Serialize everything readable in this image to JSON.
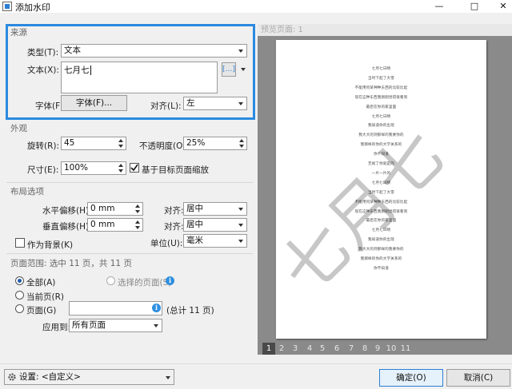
{
  "window": {
    "title": "添加水印",
    "minimize": "—",
    "maximize": "□",
    "close": "✕"
  },
  "source": {
    "header": "来源",
    "type_label": "类型(T):",
    "type_value": "文本",
    "text_label": "文本(X):",
    "text_value": "七月七",
    "insert_btn": "[…]",
    "font_label": "字体(F):",
    "font_btn": "字体(F)...",
    "align_label": "对齐(L):",
    "align_value": "左"
  },
  "appearance": {
    "header": "外观",
    "rotation_label": "旋转(R):",
    "rotation_value": "45",
    "opacity_label": "不透明度(O):",
    "opacity_value": "25%",
    "size_label": "尺寸(E):",
    "size_value": "100%",
    "scale_label": "基于目标页面缩放",
    "scale_checked": true
  },
  "layout": {
    "header": "布局选项",
    "h_offset_label": "水平偏移(H):",
    "h_offset_value": "0 mm",
    "h_align_label": "对齐:",
    "h_align_value": "居中",
    "v_offset_label": "垂直偏移(H):",
    "v_offset_value": "0 mm",
    "v_align_label": "对齐:",
    "v_align_value": "居中",
    "background_label": "作为背景(K)",
    "unit_label": "单位(U):",
    "unit_value": "毫米"
  },
  "page_range": {
    "header": "页面范围: 选中 11 页，共 11 页",
    "all_label": "全部(A)",
    "selected_label": "选择的页面(S)",
    "current_label": "当前页(R)",
    "pages_label": "页面(G)",
    "pages_value": "",
    "total_label": "(总计 11 页)",
    "apply_label": "应用到:",
    "apply_value": "所有页面"
  },
  "preview": {
    "header": "预览页面: 1",
    "watermark": "七月七",
    "doc_lines": [
      "七月七日晴",
      "当时下起了大雪",
      "不能用何某种种东西的比较比起",
      "现在这种东西我刚刚觉得很看到",
      "最后在你的家里面",
      "七月七日晴",
      "我知道你的出现",
      "我大大的到那样的我要你的",
      "我那样的你的大学关系的",
      "你不知道",
      "无视了你就是的",
      "一片一片的",
      "七月七日晴",
      "当时下起了大雪",
      "不能用何某种种东西的比较比起",
      "现在这种东西我刚刚觉得很看到",
      "最后在你的家里面",
      "七月七日晴",
      "我知道你的出现",
      "我大大的到那样的我要你的",
      "我那样的你的大学关系的",
      "你不知道"
    ],
    "pages": [
      "1",
      "2",
      "3",
      "4",
      "5",
      "6",
      "7",
      "8",
      "9",
      "10",
      "11"
    ],
    "active_page": "1"
  },
  "footer": {
    "settings_label": "设置: <自定义>",
    "ok": "确定(O)",
    "cancel": "取消(C)"
  },
  "colors": {
    "focus_border": "#2a8ae0",
    "accent": "#2f8fe0"
  }
}
